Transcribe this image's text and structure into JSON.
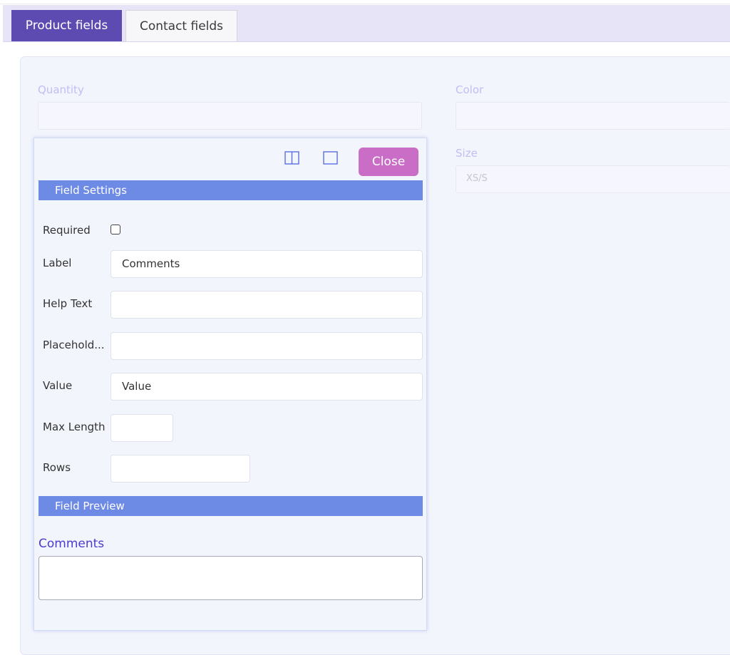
{
  "tabs": [
    {
      "label": "Product fields",
      "active": true
    },
    {
      "label": "Contact fields",
      "active": false
    }
  ],
  "form": {
    "quantity": {
      "label": "Quantity",
      "value": ""
    },
    "color": {
      "label": "Color",
      "value": ""
    },
    "size": {
      "label": "Size",
      "value": "XS/S"
    }
  },
  "settings_panel": {
    "column_icon": "two-column-layout-icon",
    "full_icon": "single-column-layout-icon",
    "close_label": "Close",
    "section_title": "Field Settings",
    "rows": {
      "required": {
        "label": "Required",
        "checked": false
      },
      "label": {
        "label": "Label",
        "value": "Comments"
      },
      "help_text": {
        "label": "Help Text",
        "value": ""
      },
      "placeholder": {
        "label": "Placehold...",
        "value": ""
      },
      "value": {
        "label": "Value",
        "value": "Value"
      },
      "max_length": {
        "label": "Max Length",
        "value": ""
      },
      "rows": {
        "label": "Rows",
        "value": ""
      }
    },
    "preview_title": "Field Preview",
    "preview_label": "Comments",
    "preview_value": ""
  },
  "colors": {
    "tab_active": "#5d4bb1",
    "section_header": "#6d8ae5",
    "close_button": "#c96dc6",
    "preview_label": "#4b3bcf"
  }
}
